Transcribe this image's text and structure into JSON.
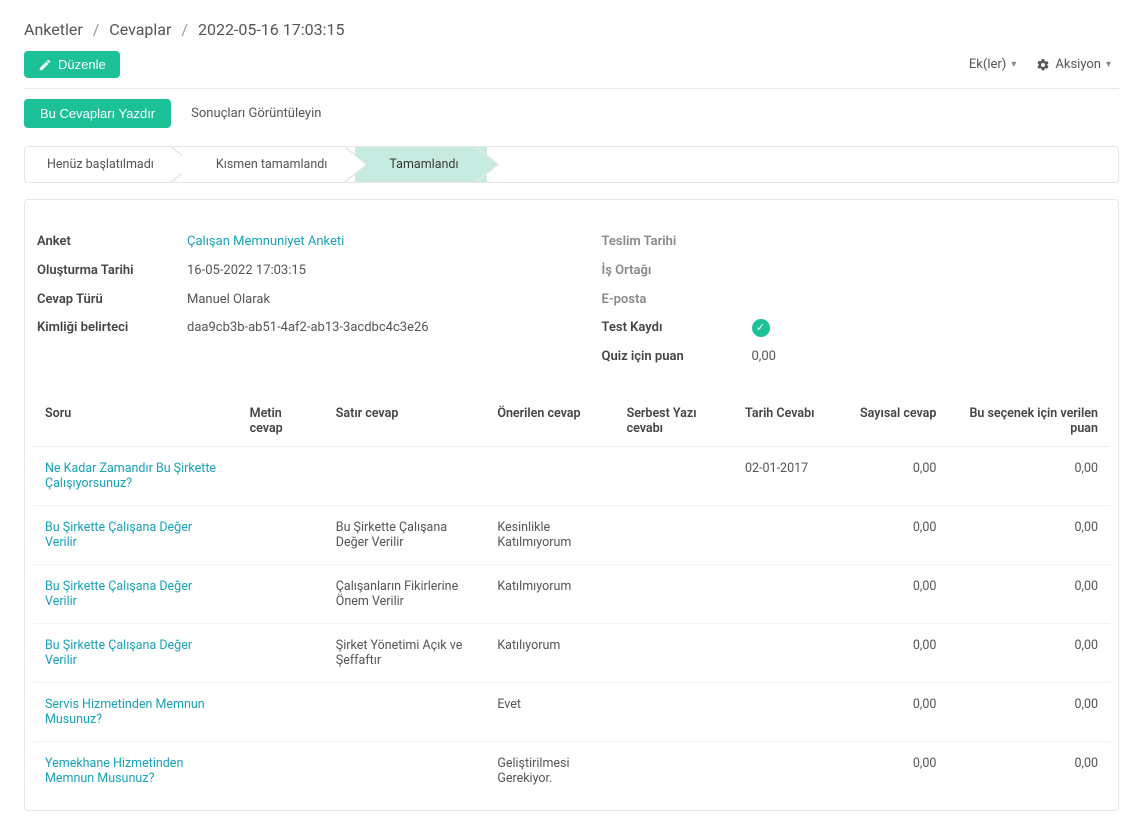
{
  "breadcrumb": {
    "l1": "Anketler",
    "l2": "Cevaplar",
    "l3": "2022-05-16 17:03:15"
  },
  "toolbar": {
    "edit": "Düzenle",
    "attachments": "Ek(ler)",
    "action": "Aksiyon"
  },
  "actions": {
    "print": "Bu Cevapları Yazdır",
    "view_results": "Sonuçları Görüntüleyin"
  },
  "status": {
    "s1": "Henüz başlatılmadı",
    "s2": "Kısmen tamamlandı",
    "s3": "Tamamlandı"
  },
  "info_left": {
    "survey_label": "Anket",
    "survey_value": "Çalışan Memnuniyet Anketi",
    "created_label": "Oluşturma Tarihi",
    "created_value": "16-05-2022 17:03:15",
    "type_label": "Cevap Türü",
    "type_value": "Manuel Olarak",
    "token_label": "Kimliği belirteci",
    "token_value": "daa9cb3b-ab51-4af2-ab13-3acdbc4c3e26"
  },
  "info_right": {
    "deadline_label": "Teslim Tarihi",
    "partner_label": "İş Ortağı",
    "email_label": "E-posta",
    "test_label": "Test Kaydı",
    "quiz_label": "Quiz için puan",
    "quiz_value": "0,00"
  },
  "table": {
    "headers": {
      "question": "Soru",
      "text": "Metin cevap",
      "row": "Satır cevap",
      "suggested": "Önerilen cevap",
      "free": "Serbest Yazı cevabı",
      "date": "Tarih Cevabı",
      "numeric": "Sayısal cevap",
      "option_score": "Bu seçenek için verilen puan"
    },
    "rows": [
      {
        "question": "Ne Kadar Zamandır Bu Şirkette Çalışıyorsunuz?",
        "text": "",
        "row": "",
        "suggested": "",
        "free": "",
        "date": "02-01-2017",
        "numeric": "0,00",
        "score": "0,00"
      },
      {
        "question": "Bu Şirkette Çalışana Değer Verilir",
        "text": "",
        "row": "Bu Şirkette Çalışana Değer Verilir",
        "suggested": "Kesinlikle Katılmıyorum",
        "free": "",
        "date": "",
        "numeric": "0,00",
        "score": "0,00"
      },
      {
        "question": "Bu Şirkette Çalışana Değer Verilir",
        "text": "",
        "row": "Çalışanların Fikirlerine Önem Verilir",
        "suggested": "Katılmıyorum",
        "free": "",
        "date": "",
        "numeric": "0,00",
        "score": "0,00"
      },
      {
        "question": "Bu Şirkette Çalışana Değer Verilir",
        "text": "",
        "row": "Şirket Yönetimi Açık ve Şeffaftır",
        "suggested": "Katılıyorum",
        "free": "",
        "date": "",
        "numeric": "0,00",
        "score": "0,00"
      },
      {
        "question": "Servis Hizmetinden Memnun Musunuz?",
        "text": "",
        "row": "",
        "suggested": "Evet",
        "free": "",
        "date": "",
        "numeric": "0,00",
        "score": "0,00"
      },
      {
        "question": "Yemekhane Hizmetinden Memnun Musunuz?",
        "text": "",
        "row": "",
        "suggested": "Geliştirilmesi Gerekiyor.",
        "free": "",
        "date": "",
        "numeric": "0,00",
        "score": "0,00"
      }
    ]
  }
}
